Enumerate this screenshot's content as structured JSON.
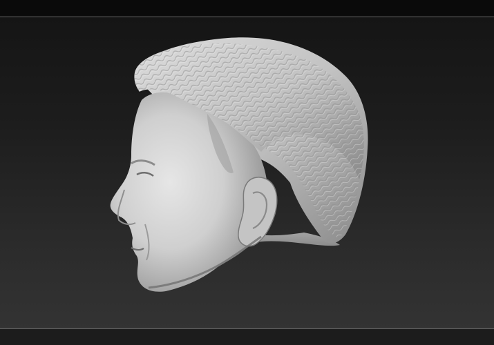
{
  "app": {
    "theme": "zbrush-dark"
  },
  "viewport": {
    "background_top": "#151515",
    "background_bottom": "#333333",
    "model": {
      "icon": "sculpted-head-model",
      "material_color": "#c9c9c9"
    }
  }
}
